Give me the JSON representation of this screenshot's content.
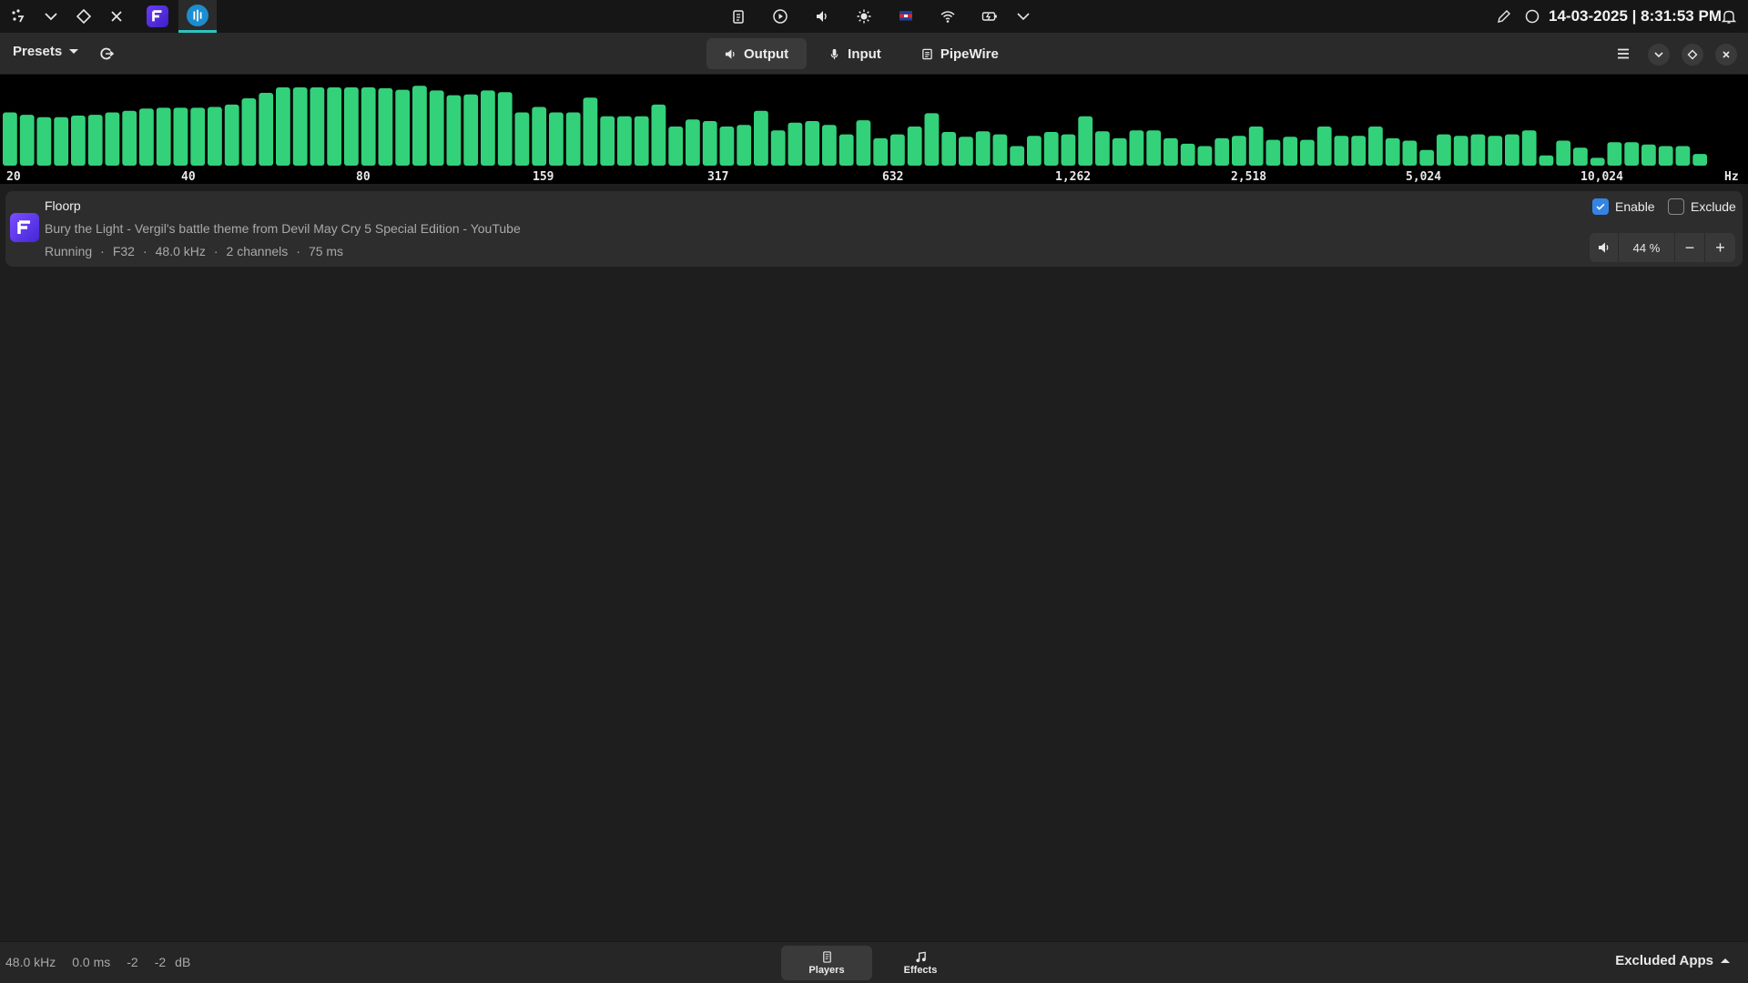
{
  "system_bar": {
    "left_icons": [
      "launcher-icon",
      "chevron-down-icon",
      "diamond-icon",
      "close-icon"
    ],
    "tasks": [
      {
        "name": "Floorp",
        "icon": "floorp-icon",
        "active": false
      },
      {
        "name": "Easy Effects",
        "icon": "easyeffects-icon",
        "active": true
      }
    ],
    "tray_icons": [
      "clipboard-icon",
      "media-play-icon",
      "volume-icon",
      "brightness-icon",
      "keyboard-layout-icon",
      "wifi-icon",
      "battery-icon",
      "tray-expand-icon"
    ],
    "keyboard_layout": "kh",
    "datetime": "14-03-2025 | 8:31:53 PM"
  },
  "header": {
    "presets_label": "Presets",
    "tabs": [
      {
        "label": "Output",
        "icon": "speaker-icon",
        "active": true
      },
      {
        "label": "Input",
        "icon": "microphone-icon",
        "active": false
      },
      {
        "label": "PipeWire",
        "icon": "pipewire-icon",
        "active": false
      }
    ]
  },
  "spectrum": {
    "unit": "Hz",
    "freq_labels": [
      "20",
      "40",
      "80",
      "159",
      "317",
      "632",
      "1,262",
      "2,518",
      "5,024",
      "10,024"
    ],
    "levels": [
      0.68,
      0.65,
      0.62,
      0.62,
      0.64,
      0.65,
      0.68,
      0.7,
      0.73,
      0.74,
      0.74,
      0.74,
      0.75,
      0.78,
      0.86,
      0.93,
      1.0,
      1.0,
      1.0,
      1.0,
      1.0,
      1.0,
      0.99,
      0.97,
      1.02,
      0.96,
      0.9,
      0.91,
      0.96,
      0.94,
      0.68,
      0.75,
      0.68,
      0.68,
      0.87,
      0.63,
      0.63,
      0.63,
      0.78,
      0.5,
      0.59,
      0.57,
      0.5,
      0.52,
      0.7,
      0.45,
      0.55,
      0.57,
      0.52,
      0.4,
      0.58,
      0.35,
      0.4,
      0.5,
      0.67,
      0.43,
      0.37,
      0.44,
      0.4,
      0.25,
      0.38,
      0.43,
      0.4,
      0.63,
      0.44,
      0.35,
      0.45,
      0.45,
      0.35,
      0.28,
      0.25,
      0.35,
      0.38,
      0.5,
      0.33,
      0.37,
      0.33,
      0.5,
      0.38,
      0.38,
      0.5,
      0.35,
      0.32,
      0.2,
      0.4,
      0.38,
      0.4,
      0.38,
      0.4,
      0.45,
      0.13,
      0.32,
      0.23,
      0.1,
      0.3,
      0.3,
      0.27,
      0.25,
      0.25,
      0.15
    ]
  },
  "player": {
    "app_name": "Floorp",
    "media_title": "Bury the Light - Vergil's battle theme from Devil May Cry 5 Special Edition - YouTube",
    "state": "Running",
    "format": "F32",
    "rate": "48.0 kHz",
    "channels": "2 channels",
    "latency": "75 ms",
    "enable_label": "Enable",
    "enable_checked": true,
    "exclude_label": "Exclude",
    "exclude_checked": false,
    "volume": "44 %",
    "minus": "−",
    "plus": "+"
  },
  "bottom_bar": {
    "rate": "48.0 kHz",
    "latency": "0.0 ms",
    "left_level": "-2",
    "right_level": "-2",
    "unit": "dB",
    "nav": [
      {
        "label": "Players",
        "icon": "players-icon",
        "active": true
      },
      {
        "label": "Effects",
        "icon": "music-note-icon",
        "active": false
      }
    ],
    "excluded_label": "Excluded Apps"
  },
  "colors": {
    "spectrum_bar": "#33d17a",
    "accent": "#3584e4",
    "active_task_underline": "#2fc3bf"
  }
}
